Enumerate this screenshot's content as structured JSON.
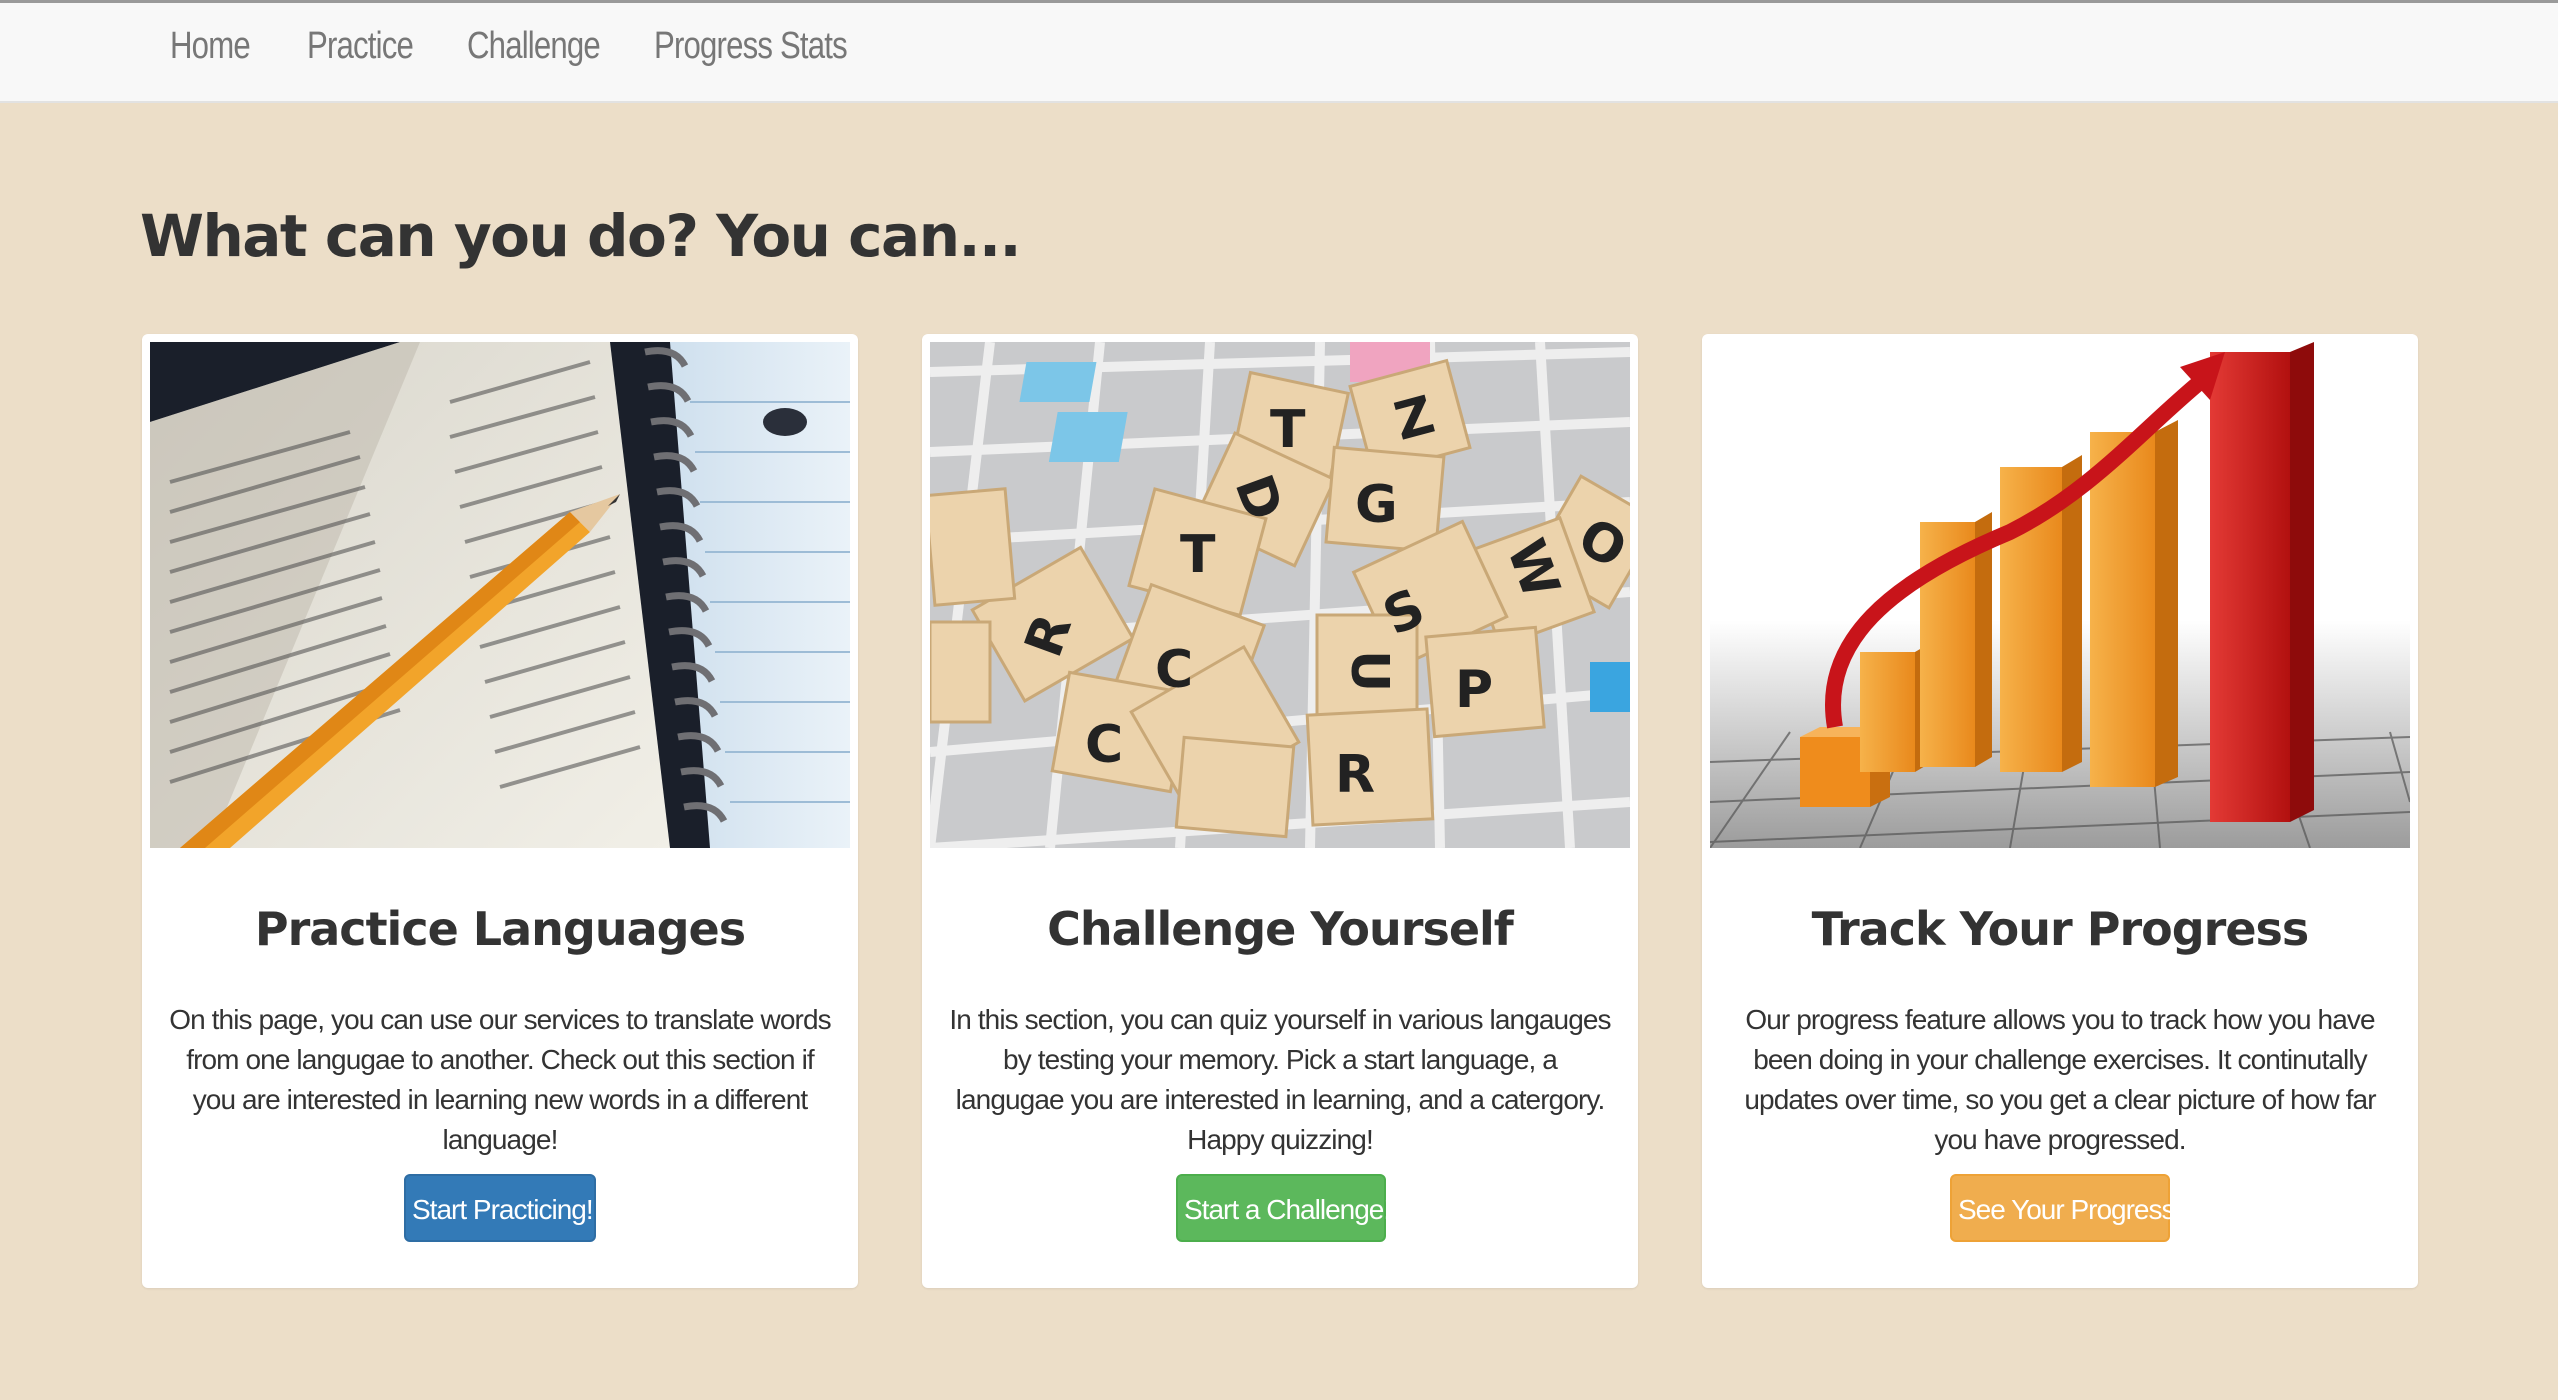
{
  "nav": {
    "items": [
      {
        "label": "Home"
      },
      {
        "label": "Practice"
      },
      {
        "label": "Challenge"
      },
      {
        "label": "Progress Stats"
      }
    ]
  },
  "main": {
    "heading": "What can you do? You can..."
  },
  "cards": [
    {
      "title": "Practice Languages",
      "description": "On this page, you can use our services to translate words from one langugae to another. Check out this section if you are interested in learning new words in a different language!",
      "button": "Start Practicing!",
      "button_color": "#337ab7",
      "image_icon": "dictionary-pencil-image"
    },
    {
      "title": "Challenge Yourself",
      "description": "In this section, you can quiz yourself in various langauges by testing your memory. Pick a start language, a langugae you are interested in learning, and a catergory. Happy quizzing!",
      "button": "Start a Challenge!",
      "button_color": "#5cb85c",
      "image_icon": "letter-tiles-image"
    },
    {
      "title": "Track Your Progress",
      "description": "Our progress feature allows you to track how you have been doing in your challenge exercises. It continutally updates over time, so you get a clear picture of how far you have progressed.",
      "button": "See Your Progress!",
      "button_color": "#f0ad4e",
      "image_icon": "growth-chart-image"
    }
  ]
}
